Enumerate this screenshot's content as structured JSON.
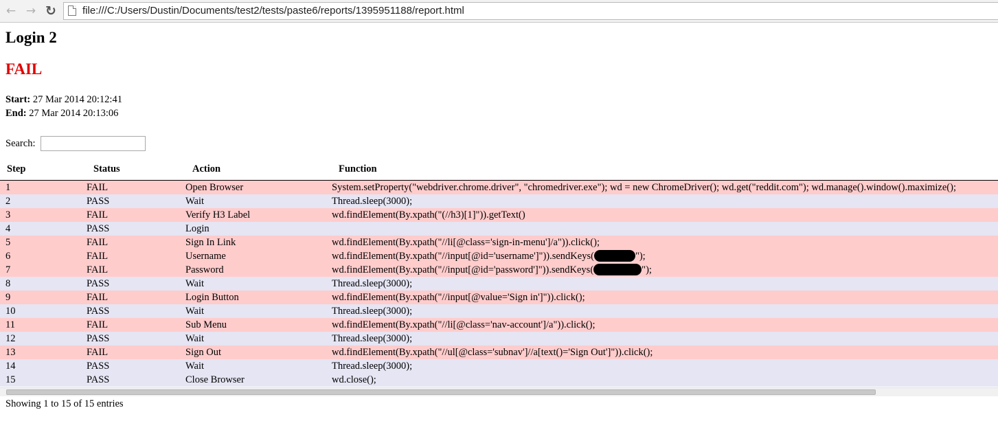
{
  "browser": {
    "url": "file:///C:/Users/Dustin/Documents/test2/tests/paste6/reports/1395951188/report.html",
    "icons": {
      "back": "back-arrow-icon",
      "forward": "forward-arrow-icon",
      "reload": "reload-icon",
      "page": "page-icon"
    }
  },
  "report": {
    "title": "Login 2",
    "status": "FAIL",
    "start_label": "Start:",
    "start_value": "27 Mar 2014 20:12:41",
    "end_label": "End:",
    "end_value": "27 Mar 2014 20:13:06"
  },
  "search": {
    "label": "Search:",
    "value": ""
  },
  "table": {
    "columns": [
      "Step",
      "Status",
      "Action",
      "Function"
    ],
    "rows": [
      {
        "step": "1",
        "status": "FAIL",
        "action": "Open Browser",
        "function": "System.setProperty(\"webdriver.chrome.driver\", \"chromedriver.exe\"); wd = new ChromeDriver(); wd.get(\"reddit.com\"); wd.manage().window().maximize();"
      },
      {
        "step": "2",
        "status": "PASS",
        "action": "Wait",
        "function": "Thread.sleep(3000);"
      },
      {
        "step": "3",
        "status": "FAIL",
        "action": "Verify H3 Label",
        "function": "wd.findElement(By.xpath(\"(//h3)[1]\")).getText()"
      },
      {
        "step": "4",
        "status": "PASS",
        "action": "Login",
        "function": ""
      },
      {
        "step": "5",
        "status": "FAIL",
        "action": "Sign In Link",
        "function": "wd.findElement(By.xpath(\"//li[@class='sign-in-menu']/a\")).click();"
      },
      {
        "step": "6",
        "status": "FAIL",
        "action": "Username",
        "function_pre": "wd.findElement(By.xpath(\"//input[@id='username']\")).sendKeys(",
        "function_post": "\");",
        "redacted": true
      },
      {
        "step": "7",
        "status": "FAIL",
        "action": "Password",
        "function_pre": "wd.findElement(By.xpath(\"//input[@id='password']\")).sendKeys(",
        "function_post": "\");",
        "redacted": true
      },
      {
        "step": "8",
        "status": "PASS",
        "action": "Wait",
        "function": "Thread.sleep(3000);"
      },
      {
        "step": "9",
        "status": "FAIL",
        "action": "Login Button",
        "function": "wd.findElement(By.xpath(\"//input[@value='Sign in']\")).click();"
      },
      {
        "step": "10",
        "status": "PASS",
        "action": "Wait",
        "function": "Thread.sleep(3000);"
      },
      {
        "step": "11",
        "status": "FAIL",
        "action": "Sub Menu",
        "function": "wd.findElement(By.xpath(\"//li[@class='nav-account']/a\")).click();"
      },
      {
        "step": "12",
        "status": "PASS",
        "action": "Wait",
        "function": "Thread.sleep(3000);"
      },
      {
        "step": "13",
        "status": "FAIL",
        "action": "Sign Out",
        "function": "wd.findElement(By.xpath(\"//ul[@class='subnav']//a[text()='Sign Out']\")).click();"
      },
      {
        "step": "14",
        "status": "PASS",
        "action": "Wait",
        "function": "Thread.sleep(3000);"
      },
      {
        "step": "15",
        "status": "PASS",
        "action": "Close Browser",
        "function": "wd.close();"
      }
    ]
  },
  "footer": {
    "info": "Showing 1 to 15 of 15 entries"
  },
  "colors": {
    "fail_status": "#e00000",
    "fail_row": "#ffcccc",
    "pass_row": "#e5e5f4"
  }
}
